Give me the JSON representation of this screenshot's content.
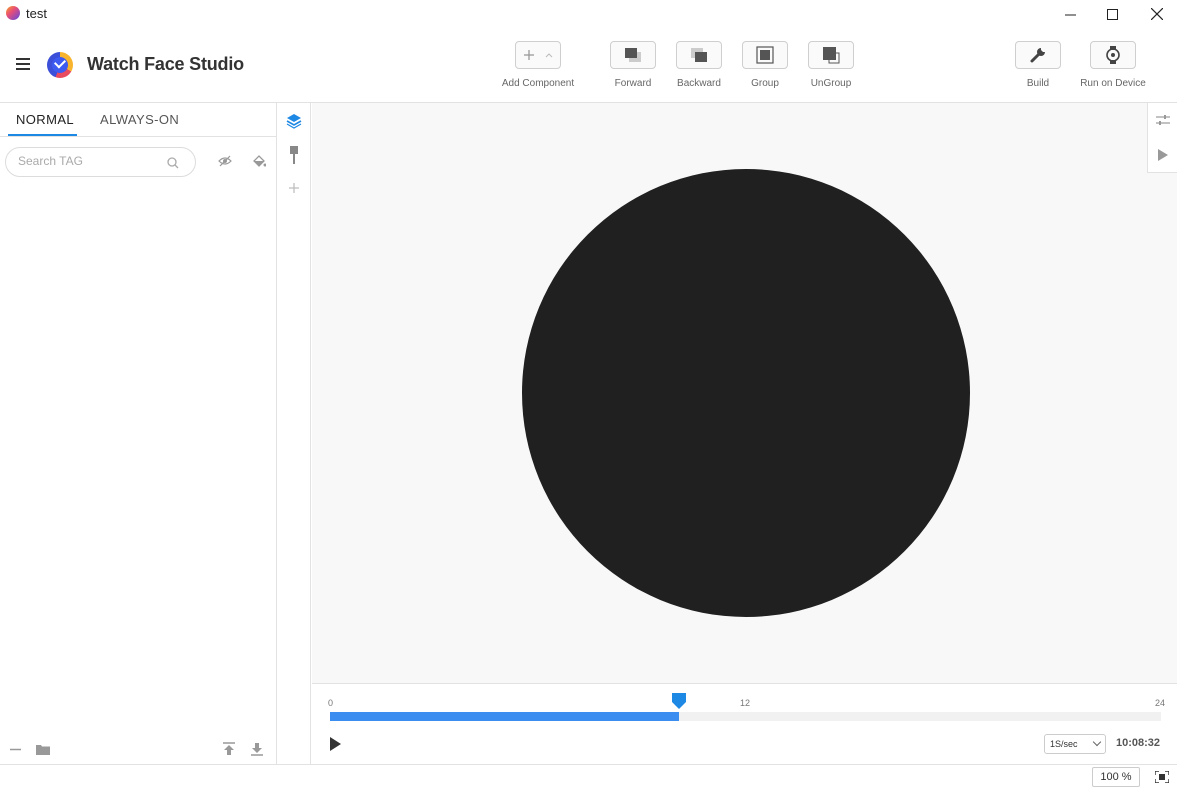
{
  "window": {
    "title": "test",
    "minimize_label": "—",
    "maximize_label": "☐",
    "close_label": "✕"
  },
  "app": {
    "name": "Watch Face Studio"
  },
  "toolbar": {
    "add_component": "Add Component",
    "forward": "Forward",
    "backward": "Backward",
    "group": "Group",
    "ungroup": "UnGroup",
    "build": "Build",
    "run_on_device": "Run on Device"
  },
  "left_panel": {
    "tabs": [
      "NORMAL",
      "ALWAYS-ON"
    ],
    "active_tab": "NORMAL",
    "search_placeholder": "Search TAG"
  },
  "timeline": {
    "ticks": [
      "0",
      "12",
      "24"
    ],
    "progress": 0.42,
    "speed": "1S/sec",
    "current_time": "10:08:32"
  },
  "statusbar": {
    "zoom": "100 %"
  },
  "colors": {
    "accent": "#1e88e5",
    "timeline_fill": "#3b8ef0",
    "watch_face": "#202020",
    "canvas_bg": "#f8f8f8"
  }
}
